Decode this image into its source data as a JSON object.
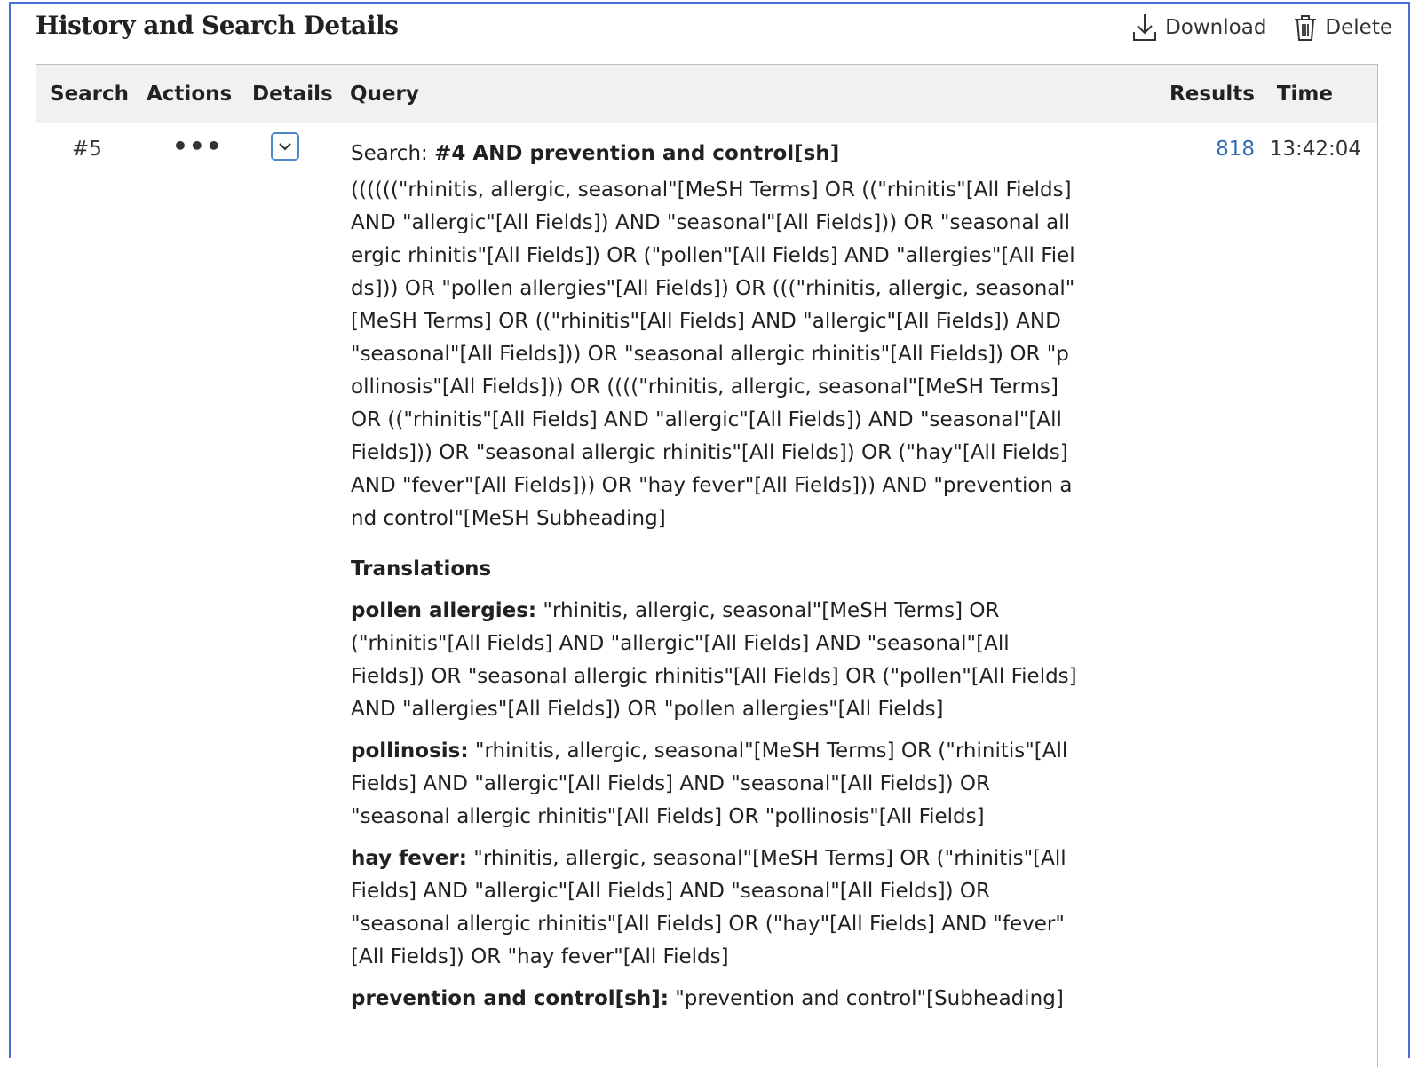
{
  "title": "History and Search Details",
  "actions": {
    "download": "Download",
    "delete": "Delete"
  },
  "columns": {
    "search": "Search",
    "actions": "Actions",
    "details": "Details",
    "query": "Query",
    "results": "Results",
    "time": "Time"
  },
  "row": {
    "number": "#5",
    "actions_icon": "•••",
    "search_prefix": "Search: ",
    "search_term": "#4 AND prevention and control[sh]",
    "query_text": "((((((\"rhinitis, allergic, seasonal\"[MeSH Terms] OR ((\"rhinitis\"[All Fields] AND \"allergic\"[All Fields]) AND \"seasonal\"[All Fields])) OR \"seasonal allergic rhinitis\"[All Fields]) OR (\"pollen\"[All Fields] AND \"allergies\"[All Fields])) OR \"pollen allergies\"[All Fields]) OR (((\"rhinitis, allergic, seasonal\"[MeSH Terms] OR ((\"rhinitis\"[All Fields] AND \"allergic\"[All Fields]) AND \"seasonal\"[All Fields])) OR \"seasonal allergic rhinitis\"[All Fields]) OR \"pollinosis\"[All Fields])) OR ((((\"rhinitis, allergic, seasonal\"[MeSH Terms] OR ((\"rhinitis\"[All Fields] AND \"allergic\"[All Fields]) AND \"seasonal\"[All Fields])) OR \"seasonal allergic rhinitis\"[All Fields]) OR (\"hay\"[All Fields] AND \"fever\"[All Fields])) OR \"hay fever\"[All Fields])) AND \"prevention and control\"[MeSH Subheading]",
    "translations_title": "Translations",
    "translations": [
      {
        "term": "pollen allergies:",
        "text": " \"rhinitis, allergic, seasonal\"[MeSH Terms] OR (\"rhinitis\"[All Fields] AND \"allergic\"[All Fields] AND \"seasonal\"[All Fields]) OR \"seasonal allergic rhinitis\"[All Fields] OR (\"pollen\"[All Fields] AND \"allergies\"[All Fields]) OR \"pollen allergies\"[All Fields]"
      },
      {
        "term": "pollinosis:",
        "text": " \"rhinitis, allergic, seasonal\"[MeSH Terms] OR (\"rhinitis\"[All Fields] AND \"allergic\"[All Fields] AND \"seasonal\"[All Fields]) OR \"seasonal allergic rhinitis\"[All Fields] OR \"pollinosis\"[All Fields]"
      },
      {
        "term": "hay fever:",
        "text": " \"rhinitis, allergic, seasonal\"[MeSH Terms] OR (\"rhinitis\"[All Fields] AND \"allergic\"[All Fields] AND \"seasonal\"[All Fields]) OR \"seasonal allergic rhinitis\"[All Fields] OR (\"hay\"[All Fields] AND \"fever\"[All Fields]) OR \"hay fever\"[All Fields]"
      },
      {
        "term": "prevention and control[sh]:",
        "text": " \"prevention and control\"[Subheading]"
      }
    ],
    "results": "818",
    "time": "13:42:04"
  },
  "colors": {
    "accent": "#4a6fd6",
    "link": "#2f6db3",
    "header_bg": "#f1f1f1"
  },
  "icons": {
    "download": "download-icon",
    "delete": "trash-icon",
    "details": "chevron-down-icon"
  }
}
